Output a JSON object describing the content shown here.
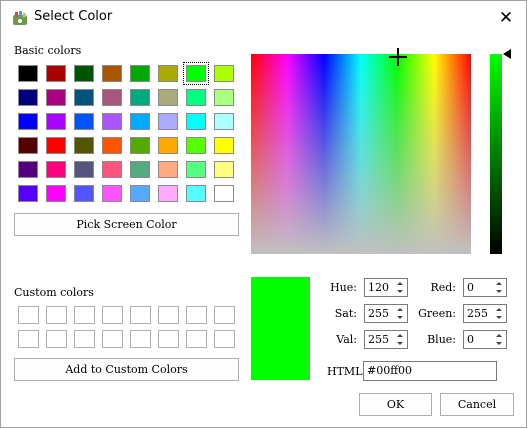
{
  "window": {
    "title": "Select Color",
    "close_glyph": "✕"
  },
  "basic_colors": {
    "label": "Basic colors",
    "rows": [
      [
        "#000000",
        "#aa0000",
        "#005500",
        "#aa5500",
        "#00aa00",
        "#aaaa00",
        "#00ff00",
        "#aaff00"
      ],
      [
        "#00007f",
        "#aa007f",
        "#00557f",
        "#aa557f",
        "#00aa7f",
        "#aaaa7f",
        "#00ff7f",
        "#aaff7f"
      ],
      [
        "#0000ff",
        "#aa00ff",
        "#0055ff",
        "#aa55ff",
        "#00aaff",
        "#aaaaff",
        "#00ffff",
        "#aaffff"
      ],
      [
        "#550000",
        "#ff0000",
        "#555500",
        "#ff5500",
        "#55aa00",
        "#ffaa00",
        "#55ff00",
        "#ffff00"
      ],
      [
        "#55007f",
        "#ff007f",
        "#55557f",
        "#ff557f",
        "#55aa7f",
        "#ffaa7f",
        "#55ff7f",
        "#ffff7f"
      ],
      [
        "#5500ff",
        "#ff00ff",
        "#5555ff",
        "#ff55ff",
        "#55aaff",
        "#ffaaff",
        "#55ffff",
        "#ffffff"
      ]
    ],
    "selected": "#00ff00"
  },
  "pick_screen_button": "Pick Screen Color",
  "custom_colors": {
    "label": "Custom colors",
    "count": 16
  },
  "add_custom_button": "Add to Custom Colors",
  "current_color": "#00ff00",
  "fields": {
    "hue": {
      "label": "Hue:",
      "value": "120"
    },
    "sat": {
      "label": "Sat:",
      "value": "255"
    },
    "val": {
      "label": "Val:",
      "value": "255"
    },
    "red": {
      "label": "Red:",
      "value": "0"
    },
    "green": {
      "label": "Green:",
      "value": "255"
    },
    "blue": {
      "label": "Blue:",
      "value": "0"
    },
    "html": {
      "label": "HTML:",
      "value": "#00ff00"
    }
  },
  "buttons": {
    "ok": "OK",
    "cancel": "Cancel"
  }
}
